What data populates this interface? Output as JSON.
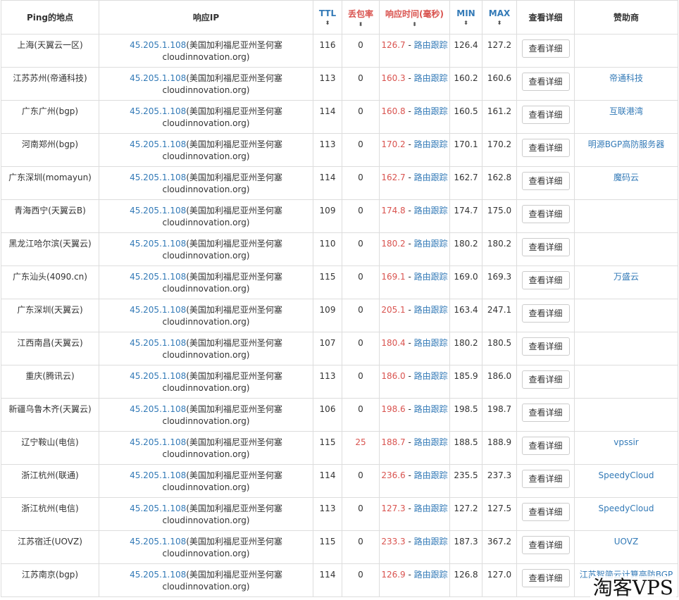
{
  "headers": {
    "location": "Ping的地点",
    "ip": "响应IP",
    "ttl": "TTL",
    "loss": "丢包率",
    "rt": "响应时间(毫秒)",
    "min": "MIN",
    "max": "MAX",
    "detail": "查看详细",
    "sponsor": "赞助商",
    "sort_icon": "⬍"
  },
  "route_label": "路由跟踪",
  "detail_label": "查看详细",
  "rows": [
    {
      "location": "上海(天翼云一区)",
      "ip": "45.205.1.108",
      "ip_loc": "(美国加利福尼亚州圣何塞",
      "host": "cloudinnovation.org)",
      "ttl": "116",
      "loss": "0",
      "rt": "126.7",
      "min": "126.4",
      "max": "127.2",
      "sponsor": ""
    },
    {
      "location": "江苏苏州(帝通科技)",
      "ip": "45.205.1.108",
      "ip_loc": "(美国加利福尼亚州圣何塞",
      "host": "cloudinnovation.org)",
      "ttl": "113",
      "loss": "0",
      "rt": "160.3",
      "min": "160.2",
      "max": "160.6",
      "sponsor": "帝通科技"
    },
    {
      "location": "广东广州(bgp)",
      "ip": "45.205.1.108",
      "ip_loc": "(美国加利福尼亚州圣何塞",
      "host": "cloudinnovation.org)",
      "ttl": "114",
      "loss": "0",
      "rt": "160.8",
      "min": "160.5",
      "max": "161.2",
      "sponsor": "互联港湾"
    },
    {
      "location": "河南郑州(bgp)",
      "ip": "45.205.1.108",
      "ip_loc": "(美国加利福尼亚州圣何塞",
      "host": "cloudinnovation.org)",
      "ttl": "113",
      "loss": "0",
      "rt": "170.2",
      "min": "170.1",
      "max": "170.2",
      "sponsor": "明源BGP高防服务器"
    },
    {
      "location": "广东深圳(momayun)",
      "ip": "45.205.1.108",
      "ip_loc": "(美国加利福尼亚州圣何塞",
      "host": "cloudinnovation.org)",
      "ttl": "114",
      "loss": "0",
      "rt": "162.7",
      "min": "162.7",
      "max": "162.8",
      "sponsor": "魔码云"
    },
    {
      "location": "青海西宁(天翼云B)",
      "ip": "45.205.1.108",
      "ip_loc": "(美国加利福尼亚州圣何塞",
      "host": "cloudinnovation.org)",
      "ttl": "109",
      "loss": "0",
      "rt": "174.8",
      "min": "174.7",
      "max": "175.0",
      "sponsor": ""
    },
    {
      "location": "黑龙江哈尔滨(天翼云)",
      "ip": "45.205.1.108",
      "ip_loc": "(美国加利福尼亚州圣何塞",
      "host": "cloudinnovation.org)",
      "ttl": "110",
      "loss": "0",
      "rt": "180.2",
      "min": "180.2",
      "max": "180.2",
      "sponsor": ""
    },
    {
      "location": "广东汕头(4090.cn)",
      "ip": "45.205.1.108",
      "ip_loc": "(美国加利福尼亚州圣何塞",
      "host": "cloudinnovation.org)",
      "ttl": "115",
      "loss": "0",
      "rt": "169.1",
      "min": "169.0",
      "max": "169.3",
      "sponsor": "万盛云"
    },
    {
      "location": "广东深圳(天翼云)",
      "ip": "45.205.1.108",
      "ip_loc": "(美国加利福尼亚州圣何塞",
      "host": "cloudinnovation.org)",
      "ttl": "109",
      "loss": "0",
      "rt": "205.1",
      "min": "163.4",
      "max": "247.1",
      "sponsor": ""
    },
    {
      "location": "江西南昌(天翼云)",
      "ip": "45.205.1.108",
      "ip_loc": "(美国加利福尼亚州圣何塞",
      "host": "cloudinnovation.org)",
      "ttl": "107",
      "loss": "0",
      "rt": "180.4",
      "min": "180.2",
      "max": "180.5",
      "sponsor": ""
    },
    {
      "location": "重庆(腾讯云)",
      "ip": "45.205.1.108",
      "ip_loc": "(美国加利福尼亚州圣何塞",
      "host": "cloudinnovation.org)",
      "ttl": "113",
      "loss": "0",
      "rt": "186.0",
      "min": "185.9",
      "max": "186.0",
      "sponsor": ""
    },
    {
      "location": "新疆乌鲁木齐(天翼云)",
      "ip": "45.205.1.108",
      "ip_loc": "(美国加利福尼亚州圣何塞",
      "host": "cloudinnovation.org)",
      "ttl": "106",
      "loss": "0",
      "rt": "198.6",
      "min": "198.5",
      "max": "198.7",
      "sponsor": ""
    },
    {
      "location": "辽宁鞍山(电信)",
      "ip": "45.205.1.108",
      "ip_loc": "(美国加利福尼亚州圣何塞",
      "host": "cloudinnovation.org)",
      "ttl": "115",
      "loss": "25",
      "rt": "188.7",
      "min": "188.5",
      "max": "188.9",
      "sponsor": "vpssir"
    },
    {
      "location": "浙江杭州(联通)",
      "ip": "45.205.1.108",
      "ip_loc": "(美国加利福尼亚州圣何塞",
      "host": "cloudinnovation.org)",
      "ttl": "114",
      "loss": "0",
      "rt": "236.6",
      "min": "235.5",
      "max": "237.3",
      "sponsor": "SpeedyCloud"
    },
    {
      "location": "浙江杭州(电信)",
      "ip": "45.205.1.108",
      "ip_loc": "(美国加利福尼亚州圣何塞",
      "host": "cloudinnovation.org)",
      "ttl": "113",
      "loss": "0",
      "rt": "127.3",
      "min": "127.2",
      "max": "127.5",
      "sponsor": "SpeedyCloud"
    },
    {
      "location": "江苏宿迁(UOVZ)",
      "ip": "45.205.1.108",
      "ip_loc": "(美国加利福尼亚州圣何塞",
      "host": "cloudinnovation.org)",
      "ttl": "115",
      "loss": "0",
      "rt": "233.3",
      "min": "187.3",
      "max": "367.2",
      "sponsor": "UOVZ"
    },
    {
      "location": "江苏南京(bgp)",
      "ip": "45.205.1.108",
      "ip_loc": "(美国加利福尼亚州圣何塞",
      "host": "cloudinnovation.org)",
      "ttl": "114",
      "loss": "0",
      "rt": "126.9",
      "min": "126.8",
      "max": "127.0",
      "sponsor": "江苏智简云计算高防BGP"
    }
  ],
  "watermark": "淘客VPS",
  "colors": {
    "link": "#337ab7",
    "alert": "#d9534f",
    "border": "#dddddd"
  }
}
